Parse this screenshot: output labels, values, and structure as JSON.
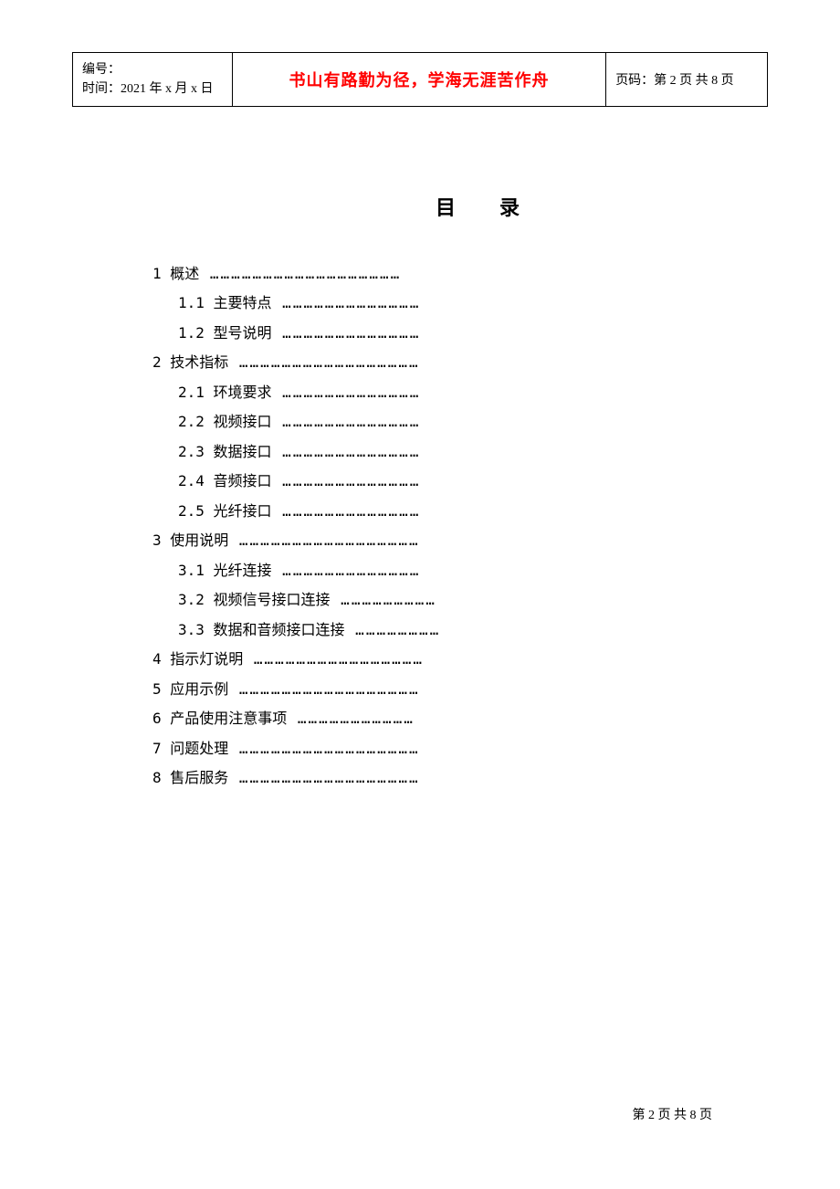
{
  "header": {
    "left_line1": "编号：",
    "left_line2": "时间：2021 年 x 月 x 日",
    "center": "书山有路勤为径，学海无涯苦作舟",
    "right": "页码：第 2 页  共 8 页"
  },
  "toc": {
    "title": "目录",
    "items": [
      {
        "level": 1,
        "label": "1 概述",
        "dots": "  ………………………………………………"
      },
      {
        "level": 2,
        "label": "1.1 主要特点",
        "dots": "  …………………………………"
      },
      {
        "level": 2,
        "label": "1.2 型号说明",
        "dots": "  …………………………………"
      },
      {
        "level": 1,
        "label": "2 技术指标",
        "dots": "  ……………………………………………"
      },
      {
        "level": 2,
        "label": "2.1 环境要求",
        "dots": "  …………………………………"
      },
      {
        "level": 2,
        "label": "2.2 视频接口",
        "dots": "  …………………………………"
      },
      {
        "level": 2,
        "label": "2.3 数据接口",
        "dots": "  …………………………………"
      },
      {
        "level": 2,
        "label": "2.4 音频接口",
        "dots": "  …………………………………"
      },
      {
        "level": 2,
        "label": "2.5 光纤接口",
        "dots": "  …………………………………"
      },
      {
        "level": 1,
        "label": "3 使用说明",
        "dots": "  ……………………………………………"
      },
      {
        "level": 2,
        "label": "3.1 光纤连接",
        "dots": "  …………………………………"
      },
      {
        "level": 2,
        "label": "3.2 视频信号接口连接",
        "dots": "  ………………………"
      },
      {
        "level": 2,
        "label": "3.3 数据和音频接口连接",
        "dots": "  ……………………"
      },
      {
        "level": 1,
        "label": "4 指示灯说明",
        "dots": "  …………………………………………"
      },
      {
        "level": 1,
        "label": "5 应用示例",
        "dots": "  ……………………………………………"
      },
      {
        "level": 1,
        "label": "6 产品使用注意事项",
        "dots": "  ……………………………"
      },
      {
        "level": 1,
        "label": "7 问题处理",
        "dots": "  ……………………………………………"
      },
      {
        "level": 1,
        "label": "8 售后服务",
        "dots": "  ……………………………………………"
      }
    ]
  },
  "footer": {
    "text": "第 2 页 共 8 页"
  }
}
